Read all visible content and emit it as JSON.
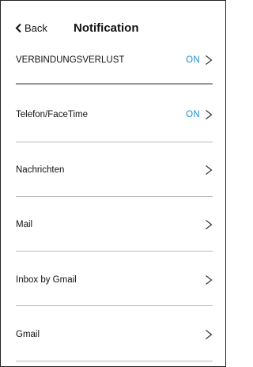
{
  "header": {
    "back_label": "Back",
    "title": "Notification"
  },
  "rows": [
    {
      "label": "VERBINDUNGSVERLUST",
      "status": "ON"
    },
    {
      "label": "Telefon/FaceTime",
      "status": "ON"
    },
    {
      "label": "Nachrichten",
      "status": ""
    },
    {
      "label": "Mail",
      "status": ""
    },
    {
      "label": "Inbox by Gmail",
      "status": ""
    },
    {
      "label": "Gmail",
      "status": ""
    }
  ],
  "colors": {
    "status": "#1b8fd8",
    "separator": "#b9b9b9"
  }
}
